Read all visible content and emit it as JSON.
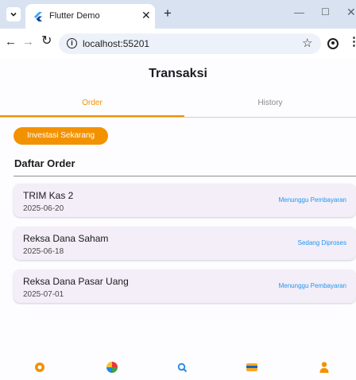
{
  "browser": {
    "tab_title": "Flutter Demo",
    "url": "localhost:55201"
  },
  "app": {
    "title": "Transaksi",
    "tabs": [
      {
        "label": "Order",
        "active": true
      },
      {
        "label": "History",
        "active": false
      }
    ],
    "invest_button": "Investasi Sekarang",
    "section_title": "Daftar Order",
    "orders": [
      {
        "name": "TRIM Kas 2",
        "date": "2025-06-20",
        "status": "Menunggu Pembayaran"
      },
      {
        "name": "Reksa Dana Saham",
        "date": "2025-06-18",
        "status": "Sedang Diproses"
      },
      {
        "name": "Reksa Dana Pasar Uang",
        "date": "2025-07-01",
        "status": "Menunggu Pembayaran"
      }
    ],
    "bottom_nav": [
      {
        "icon": "home-icon"
      },
      {
        "icon": "pie-chart-icon"
      },
      {
        "icon": "search-icon"
      },
      {
        "icon": "wallet-icon"
      },
      {
        "icon": "profile-icon"
      }
    ]
  },
  "colors": {
    "accent": "#f39200",
    "status": "#2196f3",
    "card": "#f3eef7"
  }
}
